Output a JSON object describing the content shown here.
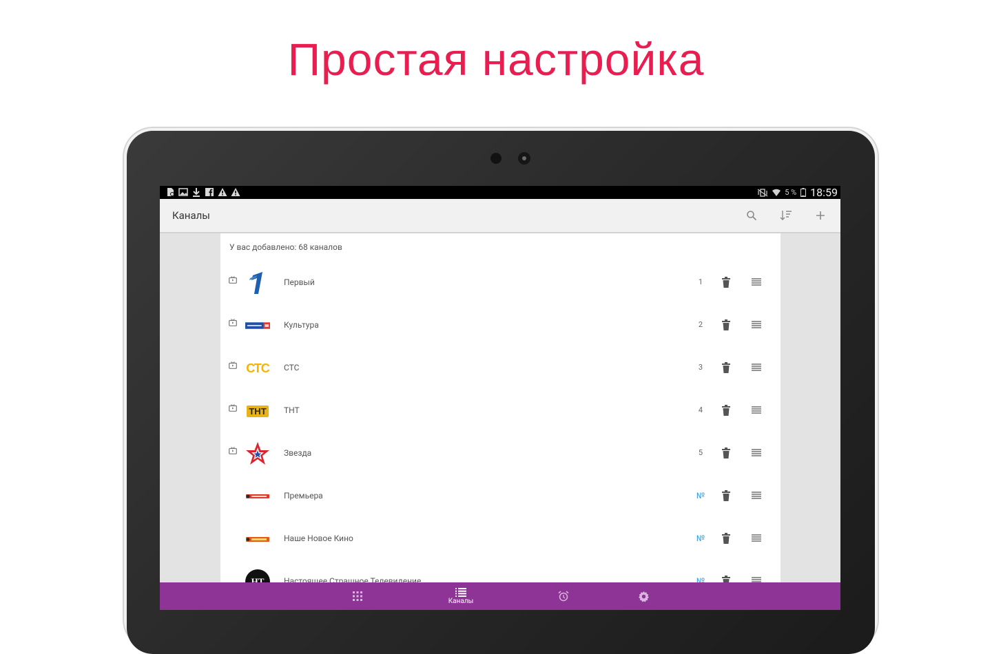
{
  "headline": "Простая настройка",
  "status_bar": {
    "battery_percent": "5 %",
    "time": "18:59",
    "left_icons": [
      "sd-card-icon",
      "image-icon",
      "download-icon",
      "facebook-icon",
      "warning-icon",
      "warning-icon"
    ]
  },
  "app_bar": {
    "title": "Каналы",
    "actions": [
      "search-icon",
      "sort-icon",
      "add-icon"
    ]
  },
  "summary": "У вас добавлено: 68 каналов",
  "channels": [
    {
      "name": "Первый",
      "number": "1",
      "logo": "perviy-logo"
    },
    {
      "name": "Культура",
      "number": "2",
      "logo": "rossiya-kultura-logo"
    },
    {
      "name": "СТС",
      "number": "3",
      "logo": "sts-logo"
    },
    {
      "name": "ТНТ",
      "number": "4",
      "logo": "tnt-logo"
    },
    {
      "name": "Звезда",
      "number": "5",
      "logo": "zvezda-logo"
    },
    {
      "name": "Премьера",
      "number": "№",
      "logo": "premiera-logo"
    },
    {
      "name": "Наше Новое Кино",
      "number": "№",
      "logo": "nashe-novoe-kino-logo"
    },
    {
      "name": "Настоящее Страшное Телевидение",
      "number": "№",
      "logo": "nst-logo"
    }
  ],
  "logo_texts": {
    "sts": "СТС",
    "tnt": "ТНТ",
    "nst": "НТ"
  },
  "bottom_nav": {
    "items": [
      {
        "icon": "grid-icon",
        "label": ""
      },
      {
        "icon": "list-icon",
        "label": "Каналы"
      },
      {
        "icon": "alarm-icon",
        "label": ""
      },
      {
        "icon": "settings-icon",
        "label": ""
      }
    ],
    "color": "#8e3496"
  },
  "colors": {
    "headline": "#e91e50",
    "accent_blue": "#2d9fe0"
  }
}
